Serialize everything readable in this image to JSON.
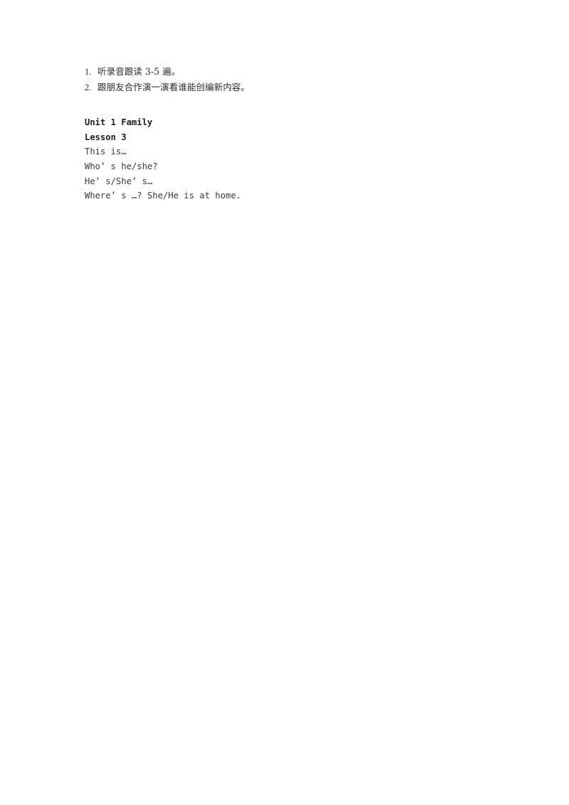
{
  "document": {
    "background_color": "#ffffff",
    "text_color": "#2b2b2b",
    "heading_color": "#1f1f1f"
  },
  "instructions": {
    "items": [
      {
        "number": "1.",
        "text": "听录音跟读 3-5 遍。"
      },
      {
        "number": "2.",
        "text": "跟朋友合作演一演看谁能创编新内容。"
      }
    ]
  },
  "lesson": {
    "unit_title": "Unit 1 Family",
    "lesson_title": "Lesson 3",
    "sentences": [
      "This is…",
      "Who’ s he/she?",
      "He’ s/She’ s…",
      "Where’ s …? She/He is at home."
    ]
  }
}
